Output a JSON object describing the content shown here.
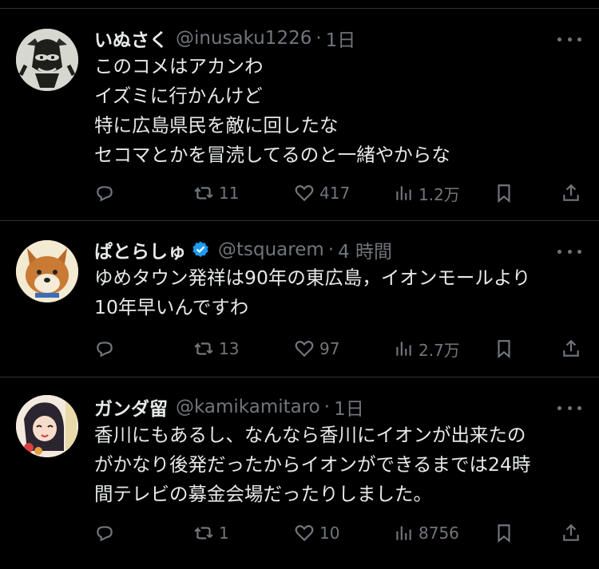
{
  "tweets": [
    {
      "name": "いぬさく",
      "handle": "@inusaku1226",
      "dot": "·",
      "time": "1日",
      "verified": false,
      "text": "このコメはアカンわ\nイズミに行かんけど\n特に広島県民を敵に回したな\nセコマとかを冒涜してるのと一緒やからな",
      "replies": "",
      "retweets": "11",
      "likes": "417",
      "views": "1.2万"
    },
    {
      "name": "ぱとらしゅ",
      "handle": "@tsquarem",
      "dot": "·",
      "time": "4 時間",
      "verified": true,
      "text": "ゆめタウン発祥は90年の東広島，イオンモールより\n10年早いんですわ",
      "replies": "",
      "retweets": "13",
      "likes": "97",
      "views": "2.7万"
    },
    {
      "name": "ガンダ留",
      "handle": "@kamikamitaro",
      "dot": "·",
      "time": "1日",
      "verified": false,
      "text": "香川にもあるし、なんなら香川にイオンが出来たの\nがかなり後発だったからイオンができるまでは24時\n間テレビの募金会場だったりしました。",
      "replies": "",
      "retweets": "1",
      "likes": "10",
      "views": "8756"
    }
  ],
  "icons": {
    "reply": "reply-icon",
    "retweet": "retweet-icon",
    "like": "heart-icon",
    "views": "bar-chart-icon",
    "bookmark": "bookmark-icon",
    "share": "share-icon",
    "more": "more-icon",
    "verified": "verified-badge-icon"
  },
  "colors": {
    "background": "#000000",
    "text": "#e7e9ea",
    "secondary": "#71767b",
    "verified": "#1d9bf0",
    "divider": "#2f3336"
  }
}
